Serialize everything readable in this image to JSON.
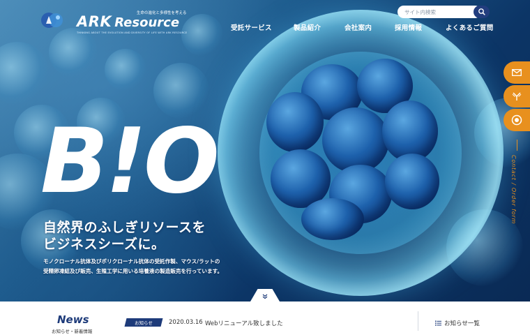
{
  "brand": {
    "name_a": "ARK",
    "name_b": "Resource",
    "tagline": "生命の進化と多様性を考える",
    "subline": "THINKING ABOUT THE EVOLUTION AND DIVERSITY OF LIFE WITH ARK RESOURCE"
  },
  "search": {
    "placeholder": "サイト内検索",
    "icon": "search-icon"
  },
  "nav": {
    "items": [
      {
        "label": "受託サービス"
      },
      {
        "label": "製品紹介"
      },
      {
        "label": "会社案内"
      },
      {
        "label": "採用情報"
      },
      {
        "label": "よくあるご質問"
      }
    ]
  },
  "side": {
    "tabs": [
      {
        "icon": "mail-icon"
      },
      {
        "icon": "antibody-icon"
      },
      {
        "icon": "circle-target-icon"
      }
    ],
    "vertical_text": "Contact / Order form"
  },
  "hero": {
    "headline": "B!O",
    "catch_line1": "自然界のふしぎリソースを",
    "catch_line2": "ビジネスシーズに。",
    "desc_line1": "モノクローナル抗体及びポリクローナル抗体の受託作製、マウス/ラットの",
    "desc_line2": "受精卵凍結及び販売、生殖工学に用いる培養液の製造販売を行っています。"
  },
  "news": {
    "title": "News",
    "subtitle": "お知らせ・新着情報",
    "badge": "お知らせ",
    "date": "2020.03.16",
    "text": "Webリニューアル致しました",
    "all_label": "お知らせ一覧"
  },
  "colors": {
    "navy": "#1e3b7a",
    "orange": "#e8901e",
    "white": "#ffffff"
  }
}
